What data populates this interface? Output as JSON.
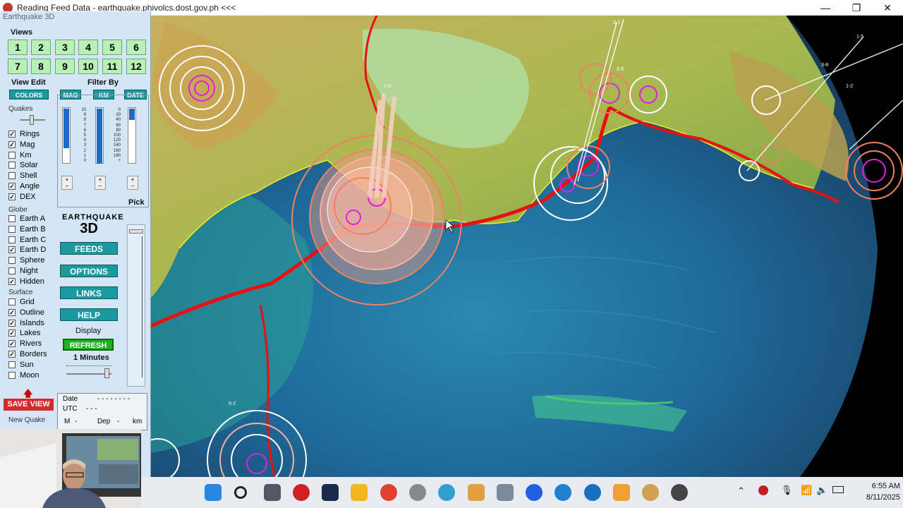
{
  "window": {
    "title": "Reading Feed Data - earthquake.phivolcs.dost.gov.ph  <<<",
    "minimize": "—",
    "maximize": "❐",
    "close": "✕"
  },
  "panel": {
    "title": "Earthquake 3D",
    "views_label": "Views",
    "view_buttons": [
      "1",
      "2",
      "3",
      "4",
      "5",
      "6",
      "7",
      "8",
      "9",
      "10",
      "11",
      "12"
    ],
    "view_edit_label": "View Edit",
    "colors_button": "COLORS",
    "filter_by_label": "Filter By",
    "filter_buttons": [
      "MAG",
      "KM",
      "DATE"
    ],
    "mag_scale": [
      "10",
      "9",
      "8",
      "7",
      "6",
      "5",
      "4",
      "3",
      "2",
      "1",
      "0"
    ],
    "km_scale": [
      "0",
      "20",
      "40",
      "60",
      "80",
      "100",
      "120",
      "140",
      "160",
      "180",
      "+"
    ],
    "quakes_label": "Quakes",
    "quake_options": [
      {
        "label": "Rings",
        "checked": true
      },
      {
        "label": "Mag",
        "checked": true
      },
      {
        "label": "Km",
        "checked": false
      },
      {
        "label": "Solar",
        "checked": false
      },
      {
        "label": "Shell",
        "checked": false
      },
      {
        "label": "Angle",
        "checked": true
      },
      {
        "label": "DEX",
        "checked": true
      }
    ],
    "globe_label": "Globe",
    "globe_options": [
      {
        "label": "Earth A",
        "checked": false
      },
      {
        "label": "Earth B",
        "checked": false
      },
      {
        "label": "Earth C",
        "checked": false
      },
      {
        "label": "Earth D",
        "checked": true
      },
      {
        "label": "Sphere",
        "checked": false
      },
      {
        "label": "Night",
        "checked": false
      },
      {
        "label": "Hidden",
        "checked": true
      }
    ],
    "surface_label": "Surface",
    "surface_options": [
      {
        "label": "Grid",
        "checked": false
      },
      {
        "label": "Outline",
        "checked": true
      },
      {
        "label": "Islands",
        "checked": true
      },
      {
        "label": "Lakes",
        "checked": true
      },
      {
        "label": "Rivers",
        "checked": true
      },
      {
        "label": "Borders",
        "checked": true
      },
      {
        "label": "Sun",
        "checked": false
      },
      {
        "label": "Moon",
        "checked": false
      }
    ],
    "logo_arc": "EARTHQUAKE",
    "logo_big": "3D",
    "pick_label": "Pick",
    "feeds_button": "FEEDS",
    "options_button": "OPTIONS",
    "links_button": "LINKS",
    "help_button": "HELP",
    "display_label": "Display",
    "refresh_button": "REFRESH",
    "interval": "1 Minutes",
    "save_view_button": "SAVE VIEW",
    "new_quake_label": "New Quake",
    "info": {
      "date_label": "Date",
      "date_value": "- - - -   - -   - -",
      "utc_label": "UTC",
      "utc_value": "-    -    -",
      "m_label": "M",
      "m_value": "-",
      "dep_label": "Dep",
      "dep_value": "-",
      "km_label": "km"
    }
  },
  "map_labels": [
    "1-5",
    "3-1",
    "3-5",
    "1-5",
    "5-2",
    "3-8",
    "1-2"
  ],
  "taskbar": {
    "time": "6:55 AM",
    "date": "8/11/2025",
    "icons": [
      "windows-start",
      "search",
      "task-view",
      "earthquake-app",
      "terminal",
      "file-explorer",
      "chrome",
      "browser-2",
      "globe-app",
      "slack",
      "calculator",
      "zoom",
      "sync-app",
      "cortana-c",
      "media-app",
      "weather-app",
      "recorder-app"
    ]
  },
  "colors": {
    "ring_white": "#ffffff",
    "ring_salmon": "#f08060",
    "epicenter": "#e020e0",
    "plate_boundary": "#e81010",
    "coast": "#f0f020",
    "ocean_deep": "#1e5a90",
    "ocean_shallow": "#30b0a0",
    "land": "#a8c060",
    "button_teal": "#1a9aa0",
    "button_green": "#22b022",
    "button_red": "#d12b2b",
    "panel_bg": "#d4e5f5"
  }
}
